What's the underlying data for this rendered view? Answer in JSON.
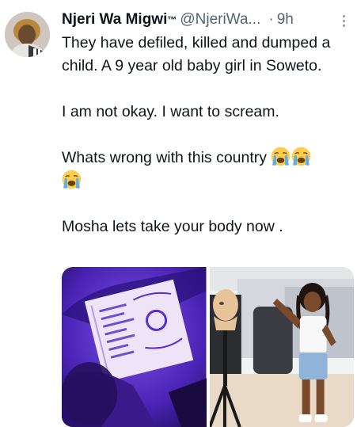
{
  "tweet": {
    "author_name": "Njeri Wa Migwi",
    "trademark": "™",
    "handle": "@NjeriWa...",
    "separator": "·",
    "time": "9h",
    "paragraphs": [
      "They have defiled, killed and dumped a child. A 9 year old baby girl  in Soweto.",
      "I am not okay. I want to scream.",
      "Whats wrong with this country",
      "Mosha lets take your body now ."
    ],
    "emojis": [
      "loudly-crying-face",
      "loudly-crying-face",
      "loudly-crying-face"
    ]
  },
  "media": {
    "photos": [
      {
        "icon": "id-document-under-purple-light-photo",
        "stamp_text": ""
      },
      {
        "icon": "girl-standing-beside-mannequin-photo"
      }
    ]
  },
  "colors": {
    "text": "#0f1419",
    "secondary": "#536471",
    "accent_purple": "#5b2fc9"
  }
}
